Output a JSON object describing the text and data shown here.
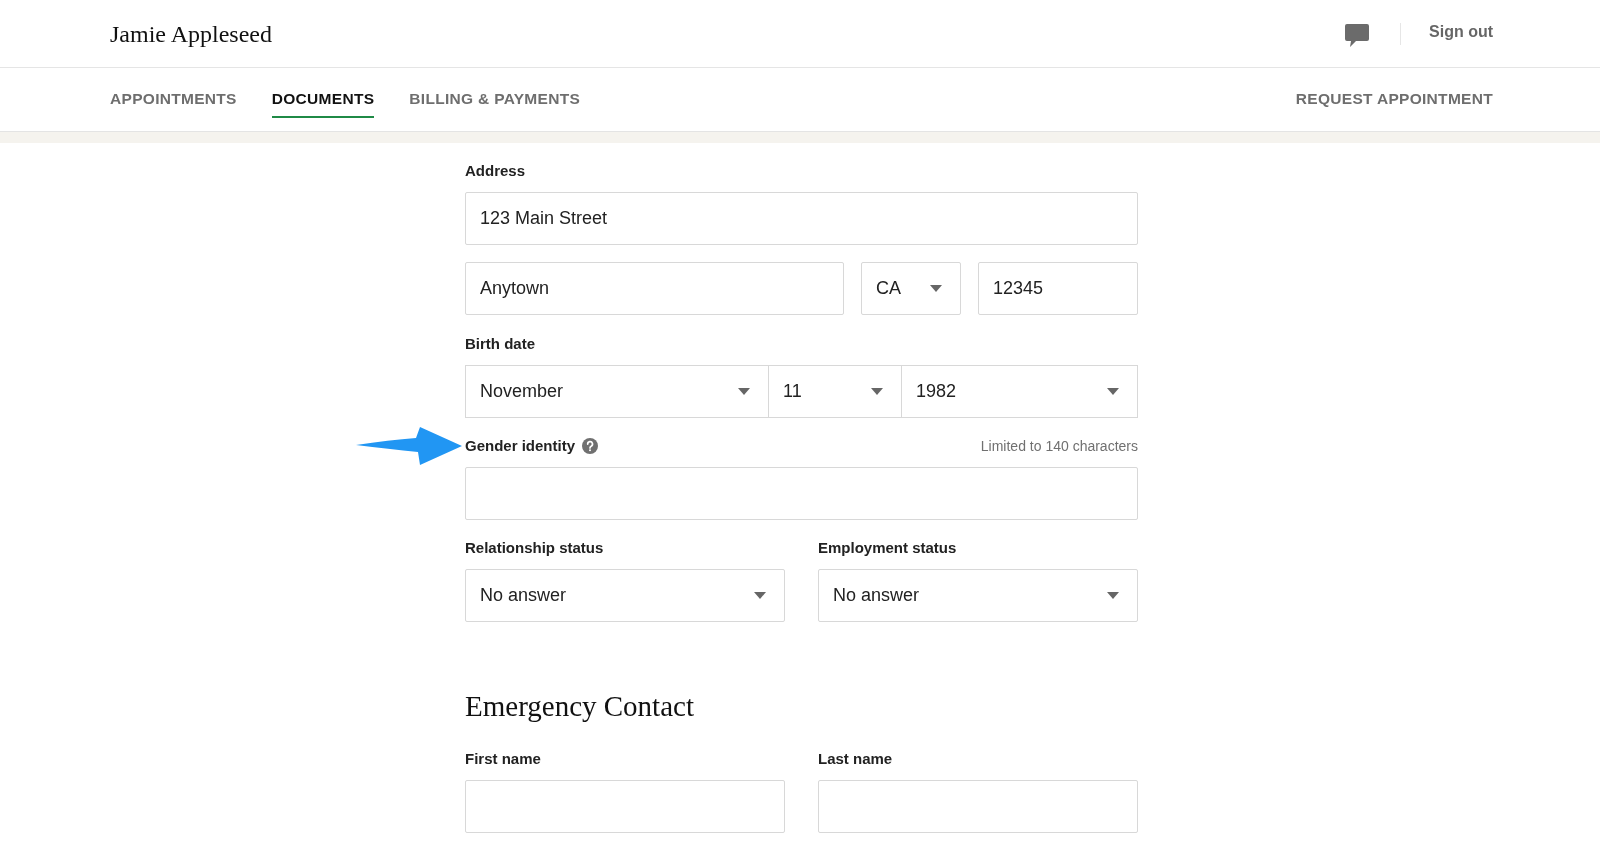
{
  "header": {
    "user_name": "Jamie Appleseed",
    "sign_out": "Sign out"
  },
  "nav": {
    "tabs": [
      {
        "label": "APPOINTMENTS",
        "selected": false
      },
      {
        "label": "DOCUMENTS",
        "selected": true
      },
      {
        "label": "BILLING & PAYMENTS",
        "selected": false
      }
    ],
    "request_appointment": "REQUEST APPOINTMENT"
  },
  "profile_form": {
    "address": {
      "label": "Address",
      "street": "123 Main Street",
      "city": "Anytown",
      "state": "CA",
      "zip": "12345"
    },
    "birth_date": {
      "label": "Birth date",
      "month": "November",
      "day": "11",
      "year": "1982"
    },
    "gender_identity": {
      "label": "Gender identity",
      "limit_note": "Limited to 140 characters"
    },
    "statuses": [
      {
        "label": "Relationship status",
        "value": "No answer"
      },
      {
        "label": "Employment status",
        "value": "No answer"
      }
    ]
  },
  "emergency_contact": {
    "title": "Emergency Contact",
    "fields": [
      {
        "label": "First name"
      },
      {
        "label": "Last name"
      }
    ]
  }
}
